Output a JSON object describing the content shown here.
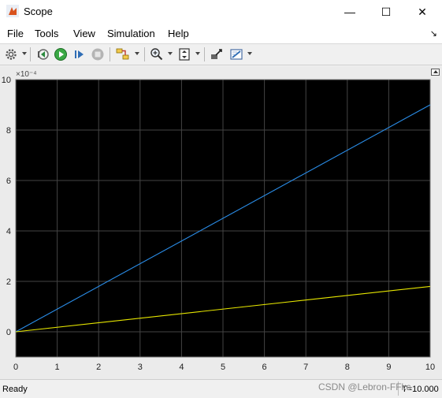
{
  "window": {
    "title": "Scope",
    "controls": {
      "minimize": "—",
      "maximize": "☐",
      "close": "✕"
    }
  },
  "menubar": {
    "items": [
      {
        "label": "File",
        "name": "menu-file"
      },
      {
        "label": "Tools",
        "name": "menu-tools"
      },
      {
        "label": "View",
        "name": "menu-view"
      },
      {
        "label": "Simulation",
        "name": "menu-simulation"
      },
      {
        "label": "Help",
        "name": "menu-help"
      }
    ],
    "pin_icon": "↘"
  },
  "toolbar": {
    "icons": [
      "gear-icon",
      "step-back-icon",
      "run-icon",
      "step-forward-icon",
      "stop-icon",
      "signal-selector-icon",
      "zoom-in-icon",
      "fit-axes-icon",
      "highlight-block-icon",
      "style-icon"
    ]
  },
  "status": {
    "text": "Ready",
    "time": "T=10.000"
  },
  "watermark": "CSDN @Lebron-FFkc",
  "colors": {
    "plot_bg": "#000000",
    "grid": "#444444",
    "series_1": "#2a8de8",
    "series_2": "#e6e600",
    "tick_text": "#e0e0e0"
  },
  "chart_data": {
    "type": "line",
    "exponent_label": "×10⁻⁴",
    "xlim": [
      0,
      10
    ],
    "ylim": [
      -1,
      10
    ],
    "xticks": [
      "0",
      "1",
      "2",
      "3",
      "4",
      "5",
      "6",
      "7",
      "8",
      "9",
      "10"
    ],
    "yticks": [
      "0",
      "2",
      "4",
      "6",
      "8",
      "10"
    ],
    "grid": true,
    "series": [
      {
        "color": "#2a8de8",
        "x": [
          0,
          10
        ],
        "y": [
          0,
          9.0
        ]
      },
      {
        "color": "#e6e600",
        "x": [
          0,
          10
        ],
        "y": [
          0,
          1.8
        ]
      }
    ]
  }
}
